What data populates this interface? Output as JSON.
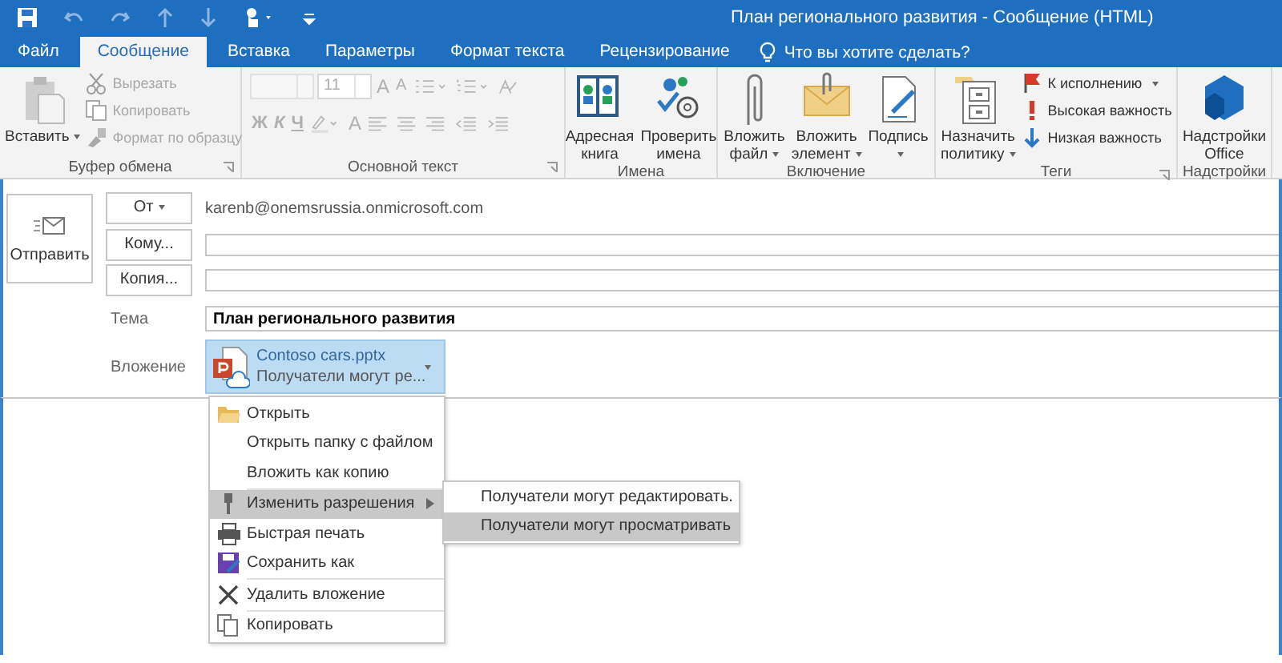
{
  "window": {
    "title": "План регионального развития - Сообщение (HTML)"
  },
  "tabs": [
    {
      "label": "Файл",
      "selected": false
    },
    {
      "label": "Сообщение",
      "selected": true
    },
    {
      "label": "Вставка",
      "selected": false
    },
    {
      "label": "Параметры",
      "selected": false
    },
    {
      "label": "Формат текста",
      "selected": false
    },
    {
      "label": "Рецензирование",
      "selected": false
    }
  ],
  "tell_me": {
    "placeholder": "Что вы хотите сделать?"
  },
  "ribbon": [
    {
      "label": "Буфер обмена",
      "launcher": true,
      "items": [
        {
          "kind": "large",
          "label": "Вставить",
          "menu": true
        },
        {
          "kind": "stack",
          "items": [
            {
              "label": "Вырезать",
              "disabled": true,
              "menu": false
            },
            {
              "label": "Копировать",
              "disabled": true,
              "menu": false
            },
            {
              "label": "Формат по образцу",
              "disabled": true,
              "menu": false
            }
          ]
        }
      ]
    },
    {
      "label": "Основной текст",
      "launcher": true,
      "items": [
        {
          "kind": "font",
          "size": "11",
          "grow": "A",
          "shrink": "A",
          "styles": [
            "Ж",
            "К",
            "Ч"
          ],
          "font_color_glyph": "A",
          "disabled": true
        }
      ]
    },
    {
      "label": "Имена",
      "items": [
        {
          "kind": "large",
          "label": "Адресная\nкнига",
          "menu": false
        },
        {
          "kind": "large",
          "label": "Проверить\nимена",
          "menu": false
        }
      ]
    },
    {
      "label": "Включение",
      "items": [
        {
          "kind": "large",
          "label": "Вложить\nфайл",
          "menu": true
        },
        {
          "kind": "large",
          "label": "Вложить\nэлемент",
          "menu": true
        },
        {
          "kind": "large",
          "label": "Подпись\n",
          "menu": true
        }
      ]
    },
    {
      "label": "Теги",
      "launcher": true,
      "items": [
        {
          "kind": "large",
          "label": "Назначить\nполитику",
          "menu": true
        },
        {
          "kind": "stack",
          "items": [
            {
              "label": "К исполнению",
              "disabled": false,
              "menu": true
            },
            {
              "label": "Высокая важность",
              "disabled": false,
              "menu": false
            },
            {
              "label": "Низкая важность",
              "disabled": false,
              "menu": false
            }
          ]
        }
      ]
    },
    {
      "label": "Надстройки",
      "items": [
        {
          "kind": "large",
          "label": "Надстройки\nOffice",
          "menu": false
        }
      ]
    }
  ],
  "compose": {
    "send": "Отправить",
    "from_button": "От",
    "from": "karenb@onemsrussia.onmicrosoft.com",
    "to_button": "Кому...",
    "cc_button": "Копия...",
    "subject_label": "Тема",
    "subject": "План регионального развития",
    "attachment_label": "Вложение",
    "attachment": {
      "name": "Contoso cars.pptx",
      "status": "Получатели могут ре...",
      "selected": true
    }
  },
  "menu": [
    {
      "label": "Открыть",
      "selected": false,
      "divider_before": false,
      "submenu": false
    },
    {
      "label": "Открыть папку с файлом",
      "selected": false,
      "divider_before": false,
      "submenu": false
    },
    {
      "label": "Вложить как копию",
      "selected": false,
      "divider_before": false,
      "submenu": false
    },
    {
      "label": "Изменить разрешения",
      "selected": true,
      "divider_before": true,
      "submenu": true
    },
    {
      "label": "Быстрая печать",
      "selected": false,
      "divider_before": false,
      "submenu": false
    },
    {
      "label": "Сохранить как",
      "selected": false,
      "divider_before": false,
      "submenu": false
    },
    {
      "label": "Удалить вложение",
      "selected": false,
      "divider_before": true,
      "submenu": false
    },
    {
      "label": "Копировать",
      "selected": false,
      "divider_before": true,
      "submenu": false
    }
  ],
  "submenu": [
    {
      "label": "Получатели могут редактировать.",
      "selected": false
    },
    {
      "label": "Получатели могут просматривать",
      "selected": true
    }
  ]
}
